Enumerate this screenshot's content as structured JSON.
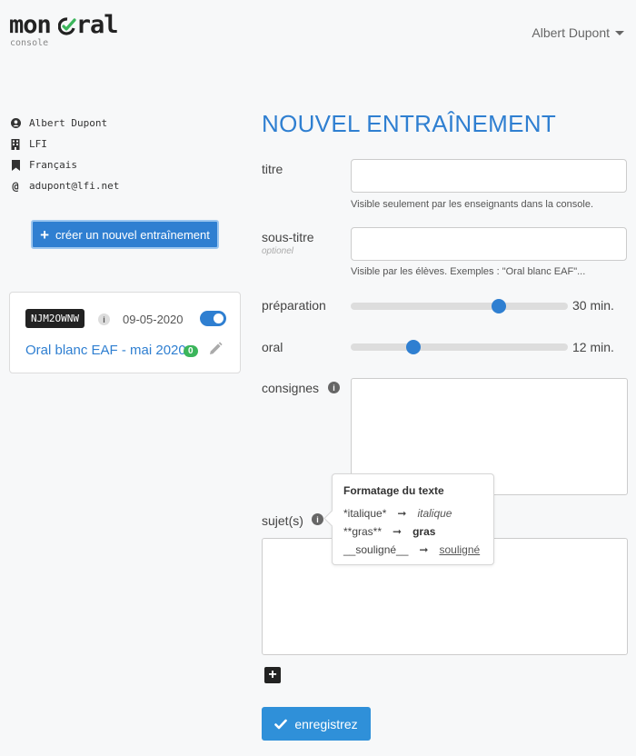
{
  "brand": {
    "logo_left": "mon",
    "logo_right": "ral",
    "subtitle": "console",
    "check_color": "#3bb55b"
  },
  "header": {
    "user_name": "Albert Dupont"
  },
  "profile": {
    "name": "Albert Dupont",
    "school": "LFI",
    "subject": "Français",
    "email": "adupont@lfi.net"
  },
  "sidebar": {
    "create_button_label": "créer un nouvel entraînement"
  },
  "training_card": {
    "code": "NJM2OWNW",
    "date": "09-05-2020",
    "title": "Oral blanc EAF - mai 2020",
    "count": "0",
    "active": true
  },
  "form": {
    "title": "NOUVEL ENTRAÎNEMENT",
    "titre_label": "titre",
    "titre_help": "Visible seulement par les enseignants dans la console.",
    "soustitre_label": "sous-titre",
    "soustitre_optional": "optionel",
    "soustitre_help": "Visible par les élèves. Exemples : \"Oral blanc EAF\"...",
    "preparation_label": "préparation",
    "preparation_value": "30 min.",
    "preparation_fraction": 0.68,
    "oral_label": "oral",
    "oral_value": "12 min.",
    "oral_fraction": 0.29,
    "consignes_label": "consignes",
    "sujets_label": "sujet(s)",
    "save_label": "enregistrez"
  },
  "tooltip": {
    "title": "Formatage du texte",
    "rows": [
      {
        "src": "*italique*",
        "dst": "italique",
        "style": "italic"
      },
      {
        "src": "**gras**",
        "dst": "gras",
        "style": "bold"
      },
      {
        "src": "__souligné__",
        "dst": "souligné",
        "style": "underline"
      }
    ]
  },
  "colors": {
    "accent": "#2f7fd1",
    "badge_green": "#3bb55b"
  }
}
